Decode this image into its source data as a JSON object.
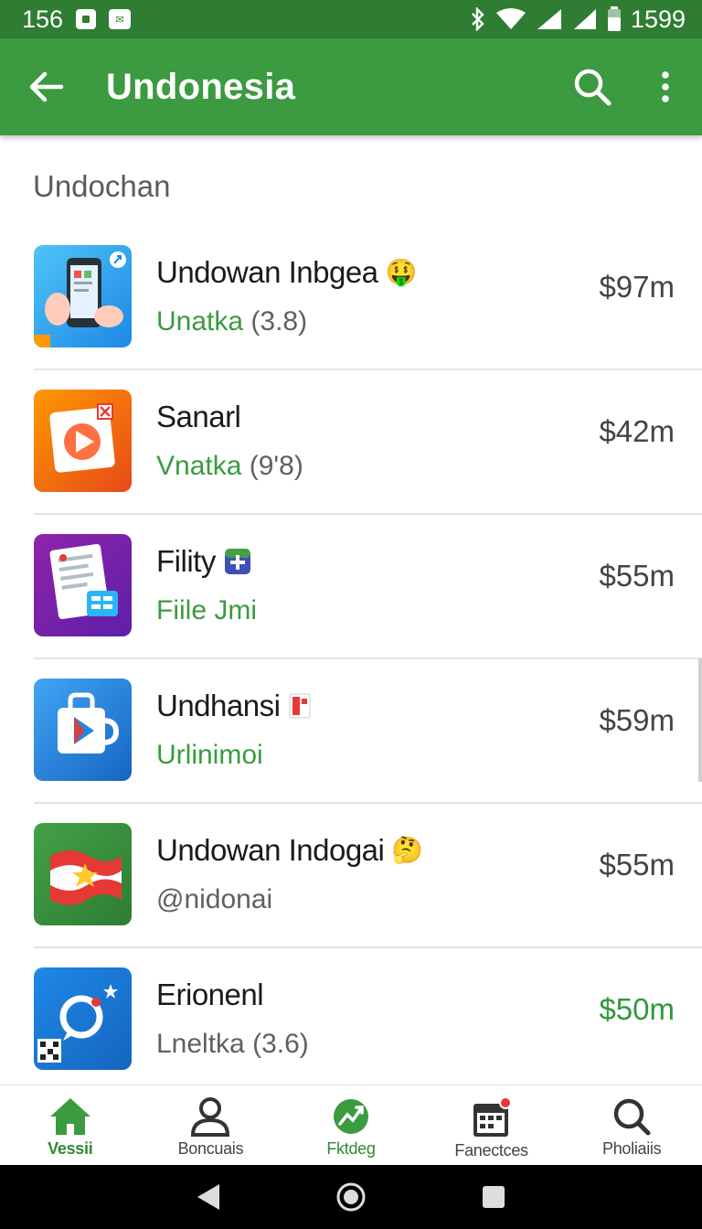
{
  "status_bar": {
    "time": "156",
    "battery": "1599"
  },
  "app_bar": {
    "title": "Undonesia"
  },
  "section": {
    "header": "Undochan"
  },
  "apps": [
    {
      "name": "Undowan Inbgea",
      "sub": "Unatka",
      "rating": "(3.8)",
      "price": "$97m"
    },
    {
      "name": "Sanarl",
      "sub": "Vnatka",
      "rating": "(9'8)",
      "price": "$42m"
    },
    {
      "name": "Fility",
      "sub": "Fiile Jmi",
      "rating": "",
      "price": "$55m"
    },
    {
      "name": "Undhansi",
      "sub": "Urlinimoi",
      "rating": "",
      "price": "$59m"
    },
    {
      "name": "Undowan Indogai",
      "sub": "@nidonai",
      "rating": "",
      "price": "$55m"
    },
    {
      "name": "Erionenl",
      "sub": "Lneltka",
      "rating": "(3.6)",
      "price": "$50m"
    }
  ],
  "bottom_nav": [
    {
      "label": "Vessii",
      "icon": "home-icon"
    },
    {
      "label": "Boncuais",
      "icon": "person-icon"
    },
    {
      "label": "Fktdeg",
      "icon": "trending-icon"
    },
    {
      "label": "Fanectces",
      "icon": "calendar-icon"
    },
    {
      "label": "Pholiaiis",
      "icon": "search-icon"
    }
  ],
  "colors": {
    "app_bar": "#3c9a40",
    "status_bar": "#2e7d32",
    "accent_green": "#3a9b3f"
  }
}
